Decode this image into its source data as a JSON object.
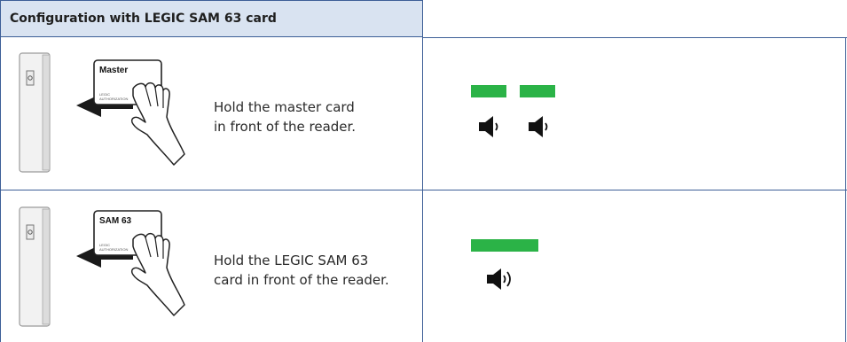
{
  "header": {
    "title": "Configuration with LEGIC SAM 63 card"
  },
  "steps": [
    {
      "card_label": "Master",
      "instruction_line1": "Hold the master card",
      "instruction_line2": "in front of the reader.",
      "signals": {
        "led_color": "#2bb347",
        "led_count": 2,
        "speaker_pattern": "short-short"
      }
    },
    {
      "card_label": "SAM 63",
      "instruction_line1": "Hold the LEGIC SAM 63",
      "instruction_line2": "card in front of the reader.",
      "signals": {
        "led_color": "#2bb347",
        "led_count": 1,
        "speaker_pattern": "long"
      }
    }
  ],
  "colors": {
    "header_bg": "#d9e3f1",
    "border": "#3d5f97",
    "led_green": "#2bb347"
  }
}
